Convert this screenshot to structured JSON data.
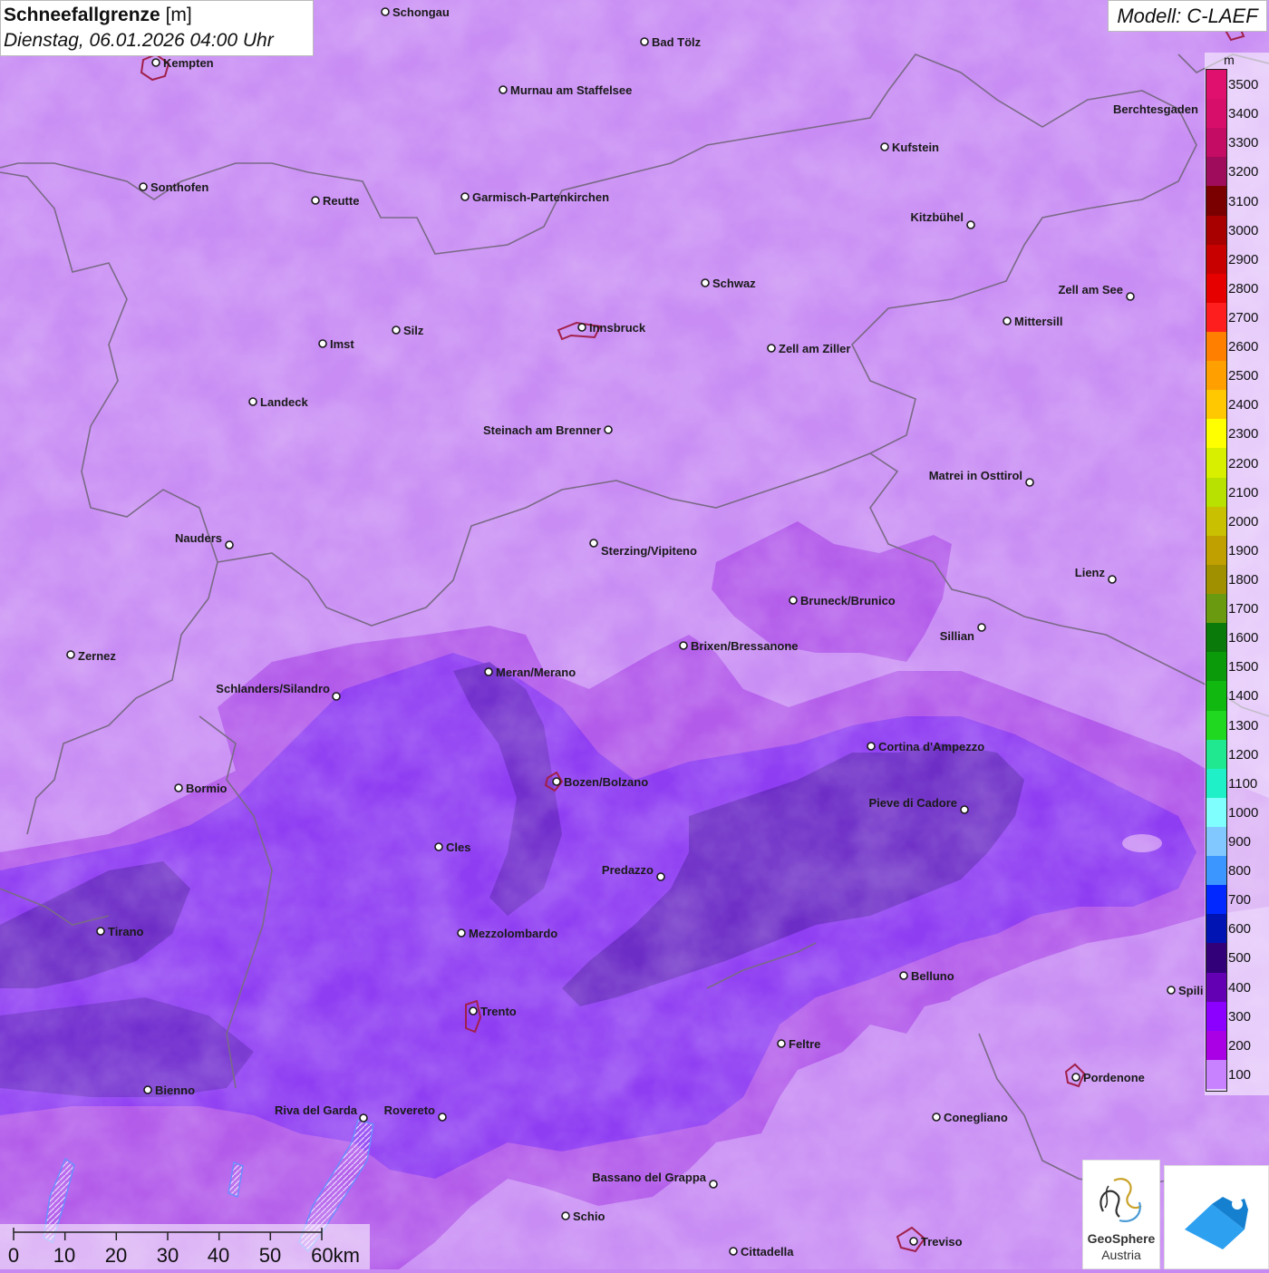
{
  "header": {
    "title_main": "Schneefallgrenze",
    "title_unit": "[m]",
    "datetime": "Dienstag, 06.01.2026 04:00 Uhr"
  },
  "model": {
    "label": "Modell: C-LAEF"
  },
  "legend": {
    "unit": "m",
    "entries": [
      {
        "label": "3500",
        "color": "#e0106e"
      },
      {
        "label": "3400",
        "color": "#d80f6a"
      },
      {
        "label": "3300",
        "color": "#c40c64"
      },
      {
        "label": "3200",
        "color": "#a00c5c"
      },
      {
        "label": "3100",
        "color": "#7a0000"
      },
      {
        "label": "3000",
        "color": "#a80000"
      },
      {
        "label": "2900",
        "color": "#c80000"
      },
      {
        "label": "2800",
        "color": "#e60000"
      },
      {
        "label": "2700",
        "color": "#ff1e1e"
      },
      {
        "label": "2600",
        "color": "#ff8000"
      },
      {
        "label": "2500",
        "color": "#ffa000"
      },
      {
        "label": "2400",
        "color": "#ffc800"
      },
      {
        "label": "2300",
        "color": "#ffff00"
      },
      {
        "label": "2200",
        "color": "#d8f000"
      },
      {
        "label": "2100",
        "color": "#b8e000"
      },
      {
        "label": "2000",
        "color": "#c8c000"
      },
      {
        "label": "1900",
        "color": "#c0a000"
      },
      {
        "label": "1800",
        "color": "#a09000"
      },
      {
        "label": "1700",
        "color": "#6a9a10"
      },
      {
        "label": "1600",
        "color": "#0a7a0a"
      },
      {
        "label": "1500",
        "color": "#0a9a0a"
      },
      {
        "label": "1400",
        "color": "#10b810"
      },
      {
        "label": "1300",
        "color": "#20d820"
      },
      {
        "label": "1200",
        "color": "#20e890"
      },
      {
        "label": "1100",
        "color": "#20f0c8"
      },
      {
        "label": "1000",
        "color": "#80ffff"
      },
      {
        "label": "900",
        "color": "#80c8ff"
      },
      {
        "label": "800",
        "color": "#3c96ff"
      },
      {
        "label": "700",
        "color": "#0028ff"
      },
      {
        "label": "600",
        "color": "#0014b4"
      },
      {
        "label": "500",
        "color": "#320078"
      },
      {
        "label": "400",
        "color": "#6400b4"
      },
      {
        "label": "300",
        "color": "#8c00ff"
      },
      {
        "label": "200",
        "color": "#aa00e6"
      },
      {
        "label": "100",
        "color": "#c882ff"
      }
    ]
  },
  "scale_bar": {
    "labels": [
      "0",
      "10",
      "20",
      "30",
      "40",
      "50",
      "60km"
    ]
  },
  "cities": [
    {
      "name": "Schongau"
    },
    {
      "name": "Bad Tölz"
    },
    {
      "name": "Kempten"
    },
    {
      "name": "Murnau am Staffelsee"
    },
    {
      "name": "Berchtesgaden"
    },
    {
      "name": "Kufstein"
    },
    {
      "name": "Sonthofen"
    },
    {
      "name": "Reutte"
    },
    {
      "name": "Garmisch-Partenkirchen"
    },
    {
      "name": "Kitzbühel"
    },
    {
      "name": "Schwaz"
    },
    {
      "name": "Zell am See"
    },
    {
      "name": "Mittersill"
    },
    {
      "name": "Innsbruck"
    },
    {
      "name": "Silz"
    },
    {
      "name": "Imst"
    },
    {
      "name": "Zell am Ziller"
    },
    {
      "name": "Landeck"
    },
    {
      "name": "Steinach am Brenner"
    },
    {
      "name": "Matrei in Osttirol"
    },
    {
      "name": "Nauders"
    },
    {
      "name": "Sterzing/Vipiteno"
    },
    {
      "name": "Lienz"
    },
    {
      "name": "Bruneck/Brunico"
    },
    {
      "name": "Sillian"
    },
    {
      "name": "Zernez"
    },
    {
      "name": "Brixen/Bressanone"
    },
    {
      "name": "Meran/Merano"
    },
    {
      "name": "Schlanders/Silandro"
    },
    {
      "name": "Cortina d'Ampezzo"
    },
    {
      "name": "Bozen/Bolzano"
    },
    {
      "name": "Bormio"
    },
    {
      "name": "Pieve di Cadore"
    },
    {
      "name": "Cles"
    },
    {
      "name": "Predazzo"
    },
    {
      "name": "Tirano"
    },
    {
      "name": "Mezzolombardo"
    },
    {
      "name": "Belluno"
    },
    {
      "name": "Spili"
    },
    {
      "name": "Trento"
    },
    {
      "name": "Feltre"
    },
    {
      "name": "Pordenone"
    },
    {
      "name": "Bienno"
    },
    {
      "name": "Riva del Garda"
    },
    {
      "name": "Rovereto"
    },
    {
      "name": "Conegliano"
    },
    {
      "name": "Bassano del Grappa"
    },
    {
      "name": "Schio"
    },
    {
      "name": "Treviso"
    },
    {
      "name": "Cittadella"
    }
  ],
  "logos": {
    "geosphere_line1": "GeoSphere",
    "geosphere_line2": "Austria"
  },
  "colors": {
    "band_100": "#c88cf4",
    "band_200": "#b05ae8",
    "band_300": "#8c3cf0",
    "band_400": "#6e2cc8",
    "border": "#7a6a86",
    "city_outline": "#a0204a"
  }
}
